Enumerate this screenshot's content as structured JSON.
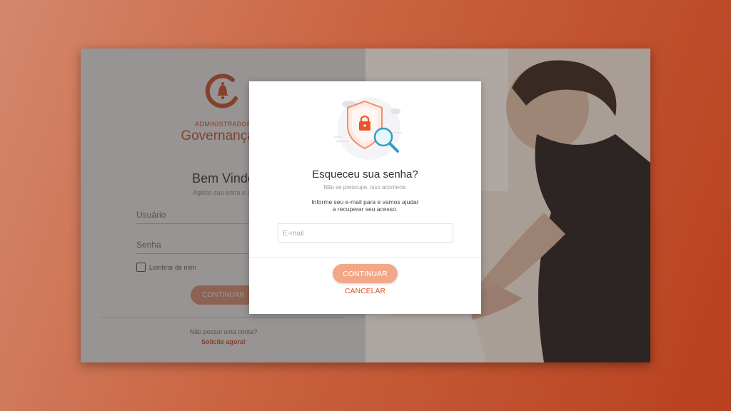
{
  "login": {
    "admin_label": "ADMINISTRADOR",
    "app_title": "Governança d",
    "welcome_title": "Bem Vindo",
    "welcome_subtitle": "Agilize sua entra e se",
    "username_placeholder": "Usuário",
    "password_placeholder": "Senha",
    "remember_label": "Lembrar de mim",
    "continue_label": "CONTINUAR",
    "no_account_text": "Não possui uma conta?",
    "request_link": "Solicite agora!"
  },
  "modal": {
    "title": "Esqueceu sua senha?",
    "subtitle": "Não se preocupe, isso acontece.",
    "info_line1": "Informe seu e-mail para e vamos ajudar",
    "info_line2": "a recuperar seu acesso.",
    "email_placeholder": "E-mail",
    "email_value": "",
    "continue_label": "CONTINUAR",
    "cancel_label": "CANCELAR"
  },
  "colors": {
    "accent": "#d9542a",
    "button_light": "#f3a789",
    "background_gradient_start": "#d4876c",
    "background_gradient_end": "#b8401e"
  }
}
